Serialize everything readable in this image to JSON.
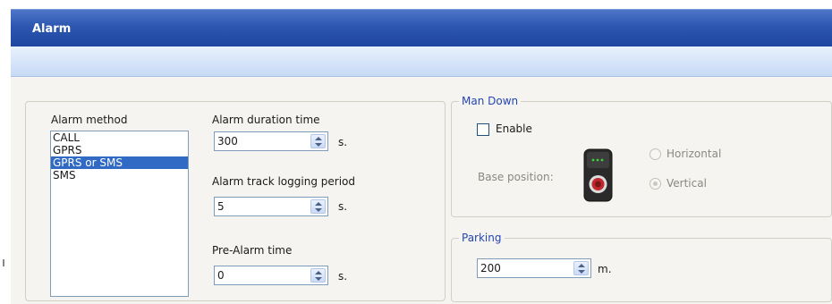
{
  "window": {
    "title": "Alarm"
  },
  "alarm": {
    "method_label": "Alarm method",
    "methods": [
      "CALL",
      "GPRS",
      "GPRS or SMS",
      "SMS"
    ],
    "selected_method": "GPRS or SMS",
    "duration_label": "Alarm duration time",
    "duration_value": "300",
    "duration_unit": "s.",
    "track_label": "Alarm track logging period",
    "track_value": "5",
    "track_unit": "s.",
    "pre_alarm_label": "Pre-Alarm time",
    "pre_alarm_value": "0",
    "pre_alarm_unit": "s."
  },
  "man_down": {
    "legend": "Man Down",
    "enable_label": "Enable",
    "enabled": false,
    "base_position_label": "Base position:",
    "horizontal_label": "Horizontal",
    "vertical_label": "Vertical",
    "selected_position": "Vertical"
  },
  "parking": {
    "legend": "Parking",
    "value": "200",
    "unit": "m."
  },
  "colors": {
    "title_bar": "#2c56b0",
    "legend_text": "#2446b4",
    "selection": "#316ac5"
  },
  "icons": [
    "spinner-up-icon",
    "spinner-down-icon",
    "device-icon"
  ]
}
